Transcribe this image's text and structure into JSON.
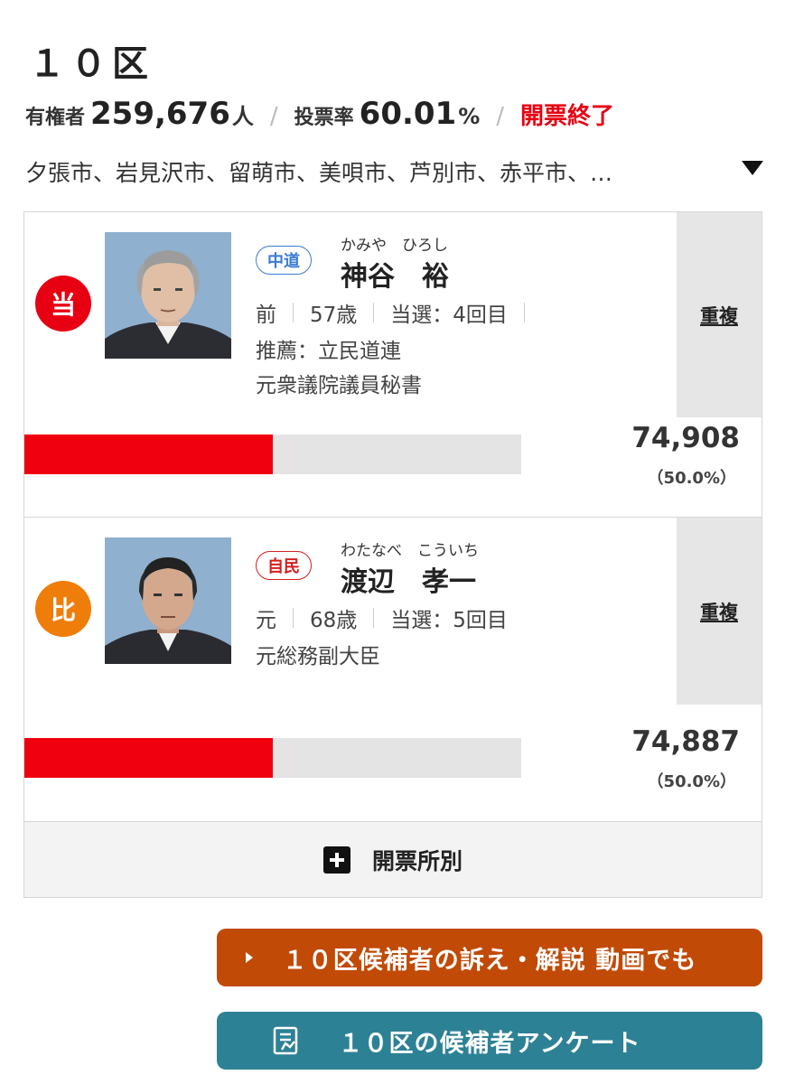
{
  "district": {
    "title": "１０区"
  },
  "stats": {
    "voters_label": "有権者",
    "voters_value": "259,676",
    "voters_unit": "人",
    "turnout_label": "投票率",
    "turnout_value": "60.01",
    "turnout_unit": "%",
    "separator": "/",
    "status": "開票終了"
  },
  "areas": {
    "text": "夕張市、岩見沢市、留萌市、美唄市、芦別市、赤平市、…"
  },
  "candidates": [
    {
      "badge": "当",
      "badge_color": "#e60012",
      "party": "中道",
      "party_color": "#3a7bd5",
      "kana": "かみや　ひろし",
      "name": "神谷　裕",
      "status": "前",
      "age": "57歳",
      "wins": "当選：4回目",
      "line2": "推薦：立民道連",
      "line3": "元衆議院議員秘書",
      "duplicate_label": "重複",
      "votes": "74,908",
      "percent_text": "（50.0%）",
      "share": 0.5
    },
    {
      "badge": "比",
      "badge_color": "#ef7d0a",
      "party": "自民",
      "party_color": "#d21f1f",
      "kana": "わたなべ　こういち",
      "name": "渡辺　孝一",
      "status": "元",
      "age": "68歳",
      "wins": "当選：5回目",
      "line2": "元総務副大臣",
      "line3": "",
      "duplicate_label": "重複",
      "votes": "74,887",
      "percent_text": "（50.0%）",
      "share": 0.5
    }
  ],
  "precinct": {
    "label": "開票所別"
  },
  "buttons": {
    "video": "１０区候補者の訴え・解説 動画でも",
    "survey": "１０区の候補者アンケート"
  },
  "colors": {
    "bar": "#f0000f",
    "status_red": "#e60012",
    "video_btn": "#c14a06",
    "survey_btn": "#2d8195"
  }
}
